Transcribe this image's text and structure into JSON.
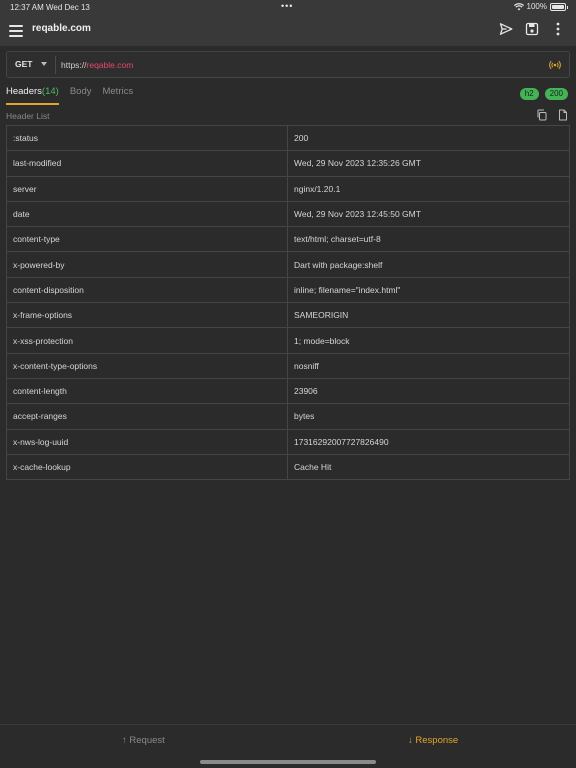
{
  "status_bar": {
    "time": "12:37 AM",
    "date": "Wed Dec 13",
    "dots": "•••",
    "battery": "100%",
    "icons": [
      "wifi-icon",
      "battery-icon"
    ]
  },
  "app_bar": {
    "title": "reqable.com",
    "icons": [
      "menu-icon",
      "send-icon",
      "save-icon",
      "more-vertical-icon"
    ]
  },
  "url_bar": {
    "method": "GET",
    "scheme": "https://",
    "host": "reqable.com",
    "icon": "websocket-signal-icon"
  },
  "tabs": [
    {
      "label": "Headers",
      "count": "(14)",
      "active": true
    },
    {
      "label": "Body",
      "count": "",
      "active": false
    },
    {
      "label": "Metrics",
      "count": "",
      "active": false
    }
  ],
  "badges": {
    "protocol": "h2",
    "status": "200"
  },
  "header_list": {
    "title": "Header List",
    "icons": [
      "copy-icon",
      "file-icon"
    ],
    "rows": [
      {
        "key": ":status",
        "value": "200"
      },
      {
        "key": "last-modified",
        "value": "Wed, 29 Nov 2023 12:35:26 GMT"
      },
      {
        "key": "server",
        "value": "nginx/1.20.1"
      },
      {
        "key": "date",
        "value": "Wed, 29 Nov 2023 12:45:50 GMT"
      },
      {
        "key": "content-type",
        "value": "text/html; charset=utf-8"
      },
      {
        "key": "x-powered-by",
        "value": "Dart with package:shelf"
      },
      {
        "key": "content-disposition",
        "value": "inline; filename=\"index.html\""
      },
      {
        "key": "x-frame-options",
        "value": "SAMEORIGIN"
      },
      {
        "key": "x-xss-protection",
        "value": "1; mode=block"
      },
      {
        "key": "x-content-type-options",
        "value": "nosniff"
      },
      {
        "key": "content-length",
        "value": "23906"
      },
      {
        "key": "accept-ranges",
        "value": "bytes"
      },
      {
        "key": "x-nws-log-uuid",
        "value": "17316292007727826490"
      },
      {
        "key": "x-cache-lookup",
        "value": "Cache Hit"
      }
    ]
  },
  "bottom_tabs": {
    "request": "↑ Request",
    "response": "↓ Response",
    "active": "response"
  },
  "colors": {
    "background": "#2b2b2b",
    "accent": "#e0a52b",
    "host": "#e8476a",
    "badge": "#46b257",
    "count": "#4dbb5f"
  }
}
